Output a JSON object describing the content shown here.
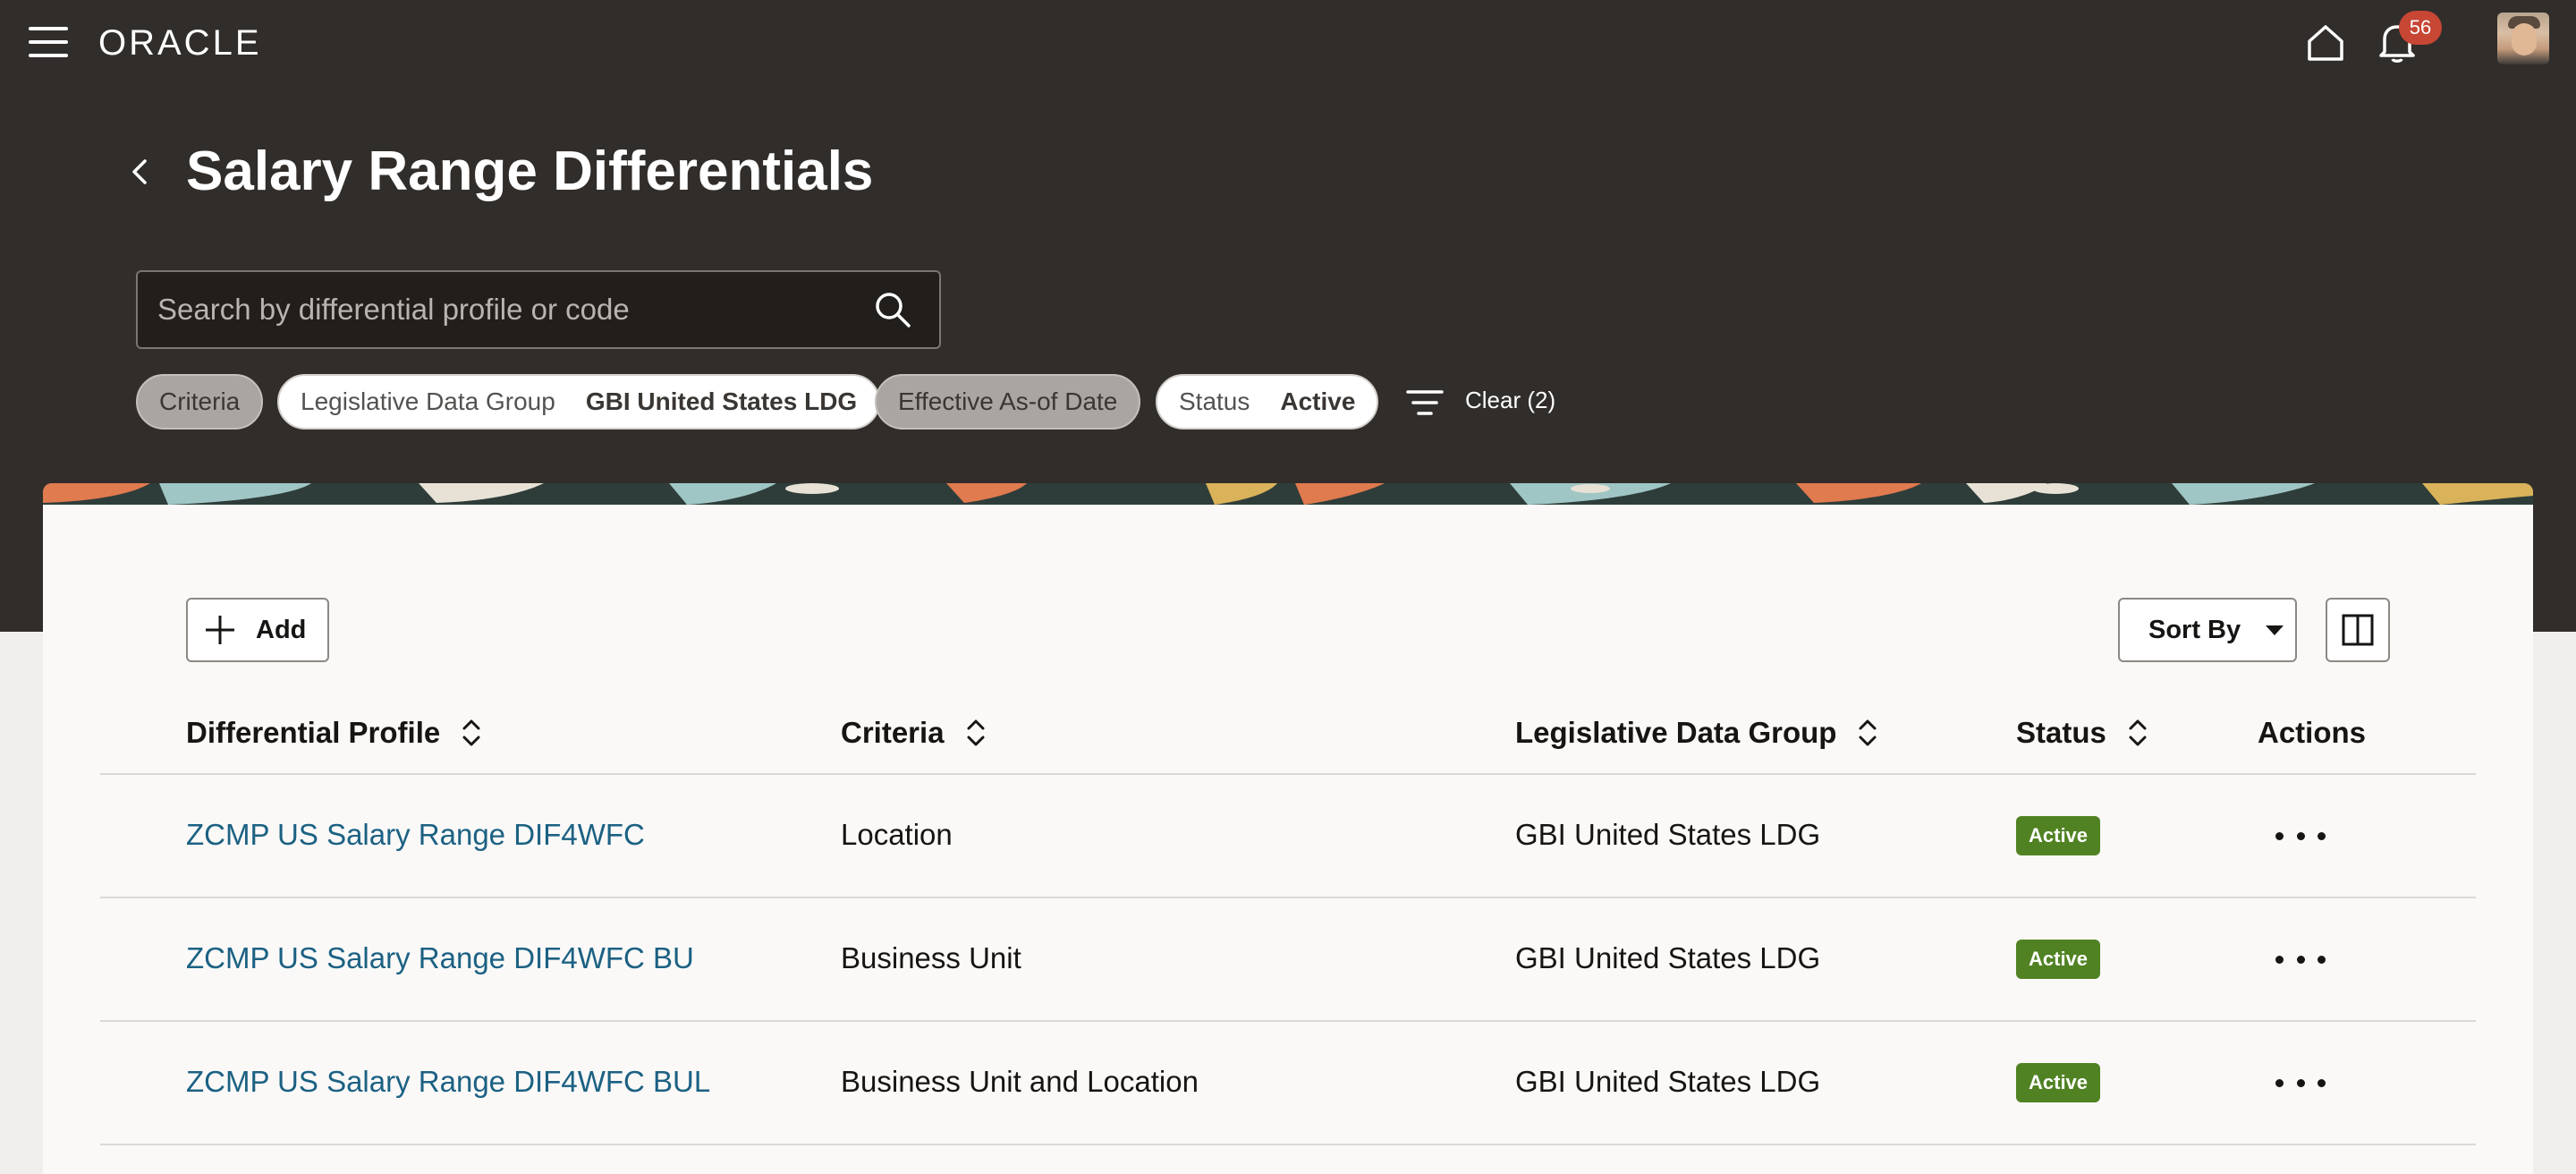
{
  "header": {
    "logo_text": "ORACLE",
    "notification_count": "56"
  },
  "page": {
    "title": "Salary Range Differentials"
  },
  "search": {
    "placeholder": "Search by differential profile or code",
    "value": ""
  },
  "filters": {
    "chips": [
      {
        "label": "Criteria",
        "value": ""
      },
      {
        "label": "Legislative Data Group",
        "value": "GBI United States LDG"
      },
      {
        "label": "Effective As-of Date",
        "value": ""
      },
      {
        "label": "Status",
        "value": "Active"
      }
    ],
    "clear_label": "Clear (2)"
  },
  "toolbar": {
    "add_label": "Add",
    "sort_label": "Sort By"
  },
  "table": {
    "headers": [
      "Differential Profile",
      "Criteria",
      "Legislative Data Group",
      "Status",
      "Actions"
    ],
    "rows": [
      {
        "profile": "ZCMP US Salary Range DIF4WFC",
        "criteria": "Location",
        "ldg": "GBI United States LDG",
        "status": "Active"
      },
      {
        "profile": "ZCMP US Salary Range DIF4WFC BU",
        "criteria": "Business Unit",
        "ldg": "GBI United States LDG",
        "status": "Active"
      },
      {
        "profile": "ZCMP US Salary Range DIF4WFC BUL",
        "criteria": "Business Unit and Location",
        "ldg": "GBI United States LDG",
        "status": "Active"
      }
    ]
  },
  "colors": {
    "header_bg": "#312d2a",
    "link": "#1c6183",
    "status_active": "#508223",
    "badge": "#c74634"
  }
}
